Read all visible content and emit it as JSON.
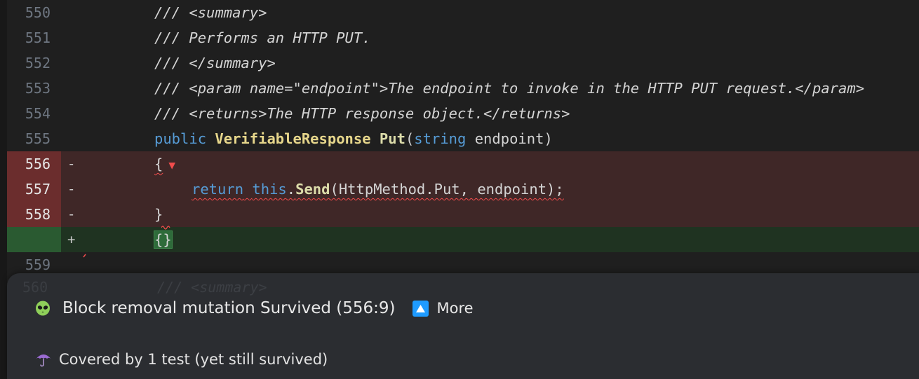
{
  "editor": {
    "lines": [
      {
        "num": "550",
        "text": "/// <summary>"
      },
      {
        "num": "551",
        "text": "/// Performs an HTTP PUT."
      },
      {
        "num": "552",
        "text": "/// </summary>"
      },
      {
        "num": "553",
        "text": "/// <param name=\"endpoint\">The endpoint to invoke in the HTTP PUT request.</param>"
      },
      {
        "num": "554",
        "text": "/// <returns>The HTTP response object.</returns>"
      },
      {
        "num": "555",
        "kw_public": "public",
        "type": "VerifiableResponse",
        "method": "Put",
        "paren_open": "(",
        "kw_string": "string",
        "param": " endpoint",
        "paren_close": ")"
      },
      {
        "num": "556",
        "mark": "-",
        "text": "{",
        "marker": "▼"
      },
      {
        "num": "557",
        "mark": "-",
        "kw_return": "return",
        "kw_this": "this",
        "dot": ".",
        "call": "Send",
        "args": "(HttpMethod.Put, endpoint);"
      },
      {
        "num": "558",
        "mark": "-",
        "text": "}"
      },
      {
        "num": "",
        "mark": "+",
        "text": "{}"
      },
      {
        "num": "559",
        "text": ""
      }
    ]
  },
  "popup": {
    "ghost_line_num": "560",
    "ghost_text": "/// <summary>",
    "title": "Block removal mutation Survived (556:9)",
    "more_label": "More",
    "covered": "Covered by 1 test (yet still survived)"
  },
  "icons": {
    "alien": "alien-icon",
    "more": "chevron-up-icon",
    "umbrella": "umbrella-icon"
  },
  "colors": {
    "deleted_line": "#3f2727",
    "deleted_gutter": "#6b2d2d",
    "added_line": "#1f3321",
    "added_gutter": "#2a5a31",
    "error_squiggle": "#f14c4c",
    "more_button": "#1e9bff",
    "popup_background": "#2b2d31"
  }
}
